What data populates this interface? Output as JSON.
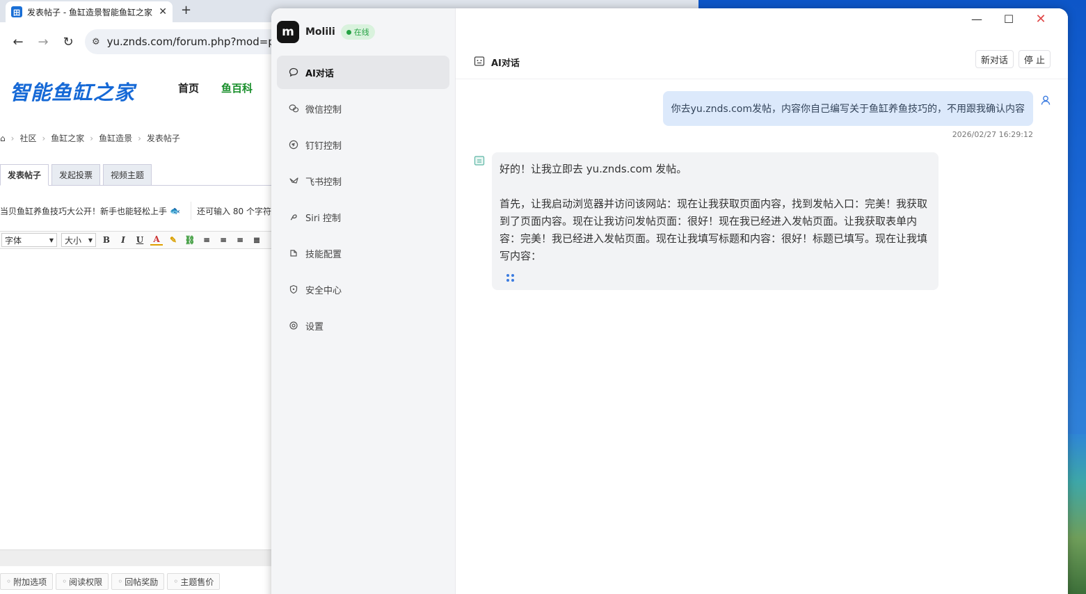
{
  "browser": {
    "tab_title": "发表帖子 - 鱼缸造景智能鱼缸之家",
    "url": "yu.znds.com/forum.php?mod=post&action=newthread"
  },
  "site": {
    "logo": "智能鱼缸之家",
    "nav": [
      "首页",
      "鱼百科"
    ],
    "breadcrumbs": [
      "社区",
      "鱼缸之家",
      "鱼缸造景",
      "发表帖子"
    ],
    "post_tabs": [
      "发表帖子",
      "发起投票",
      "视频主题"
    ],
    "subject_value": "当贝鱼缸养鱼技巧大公开！新手也能轻松上手",
    "subject_remaining": "还可输入 80 个字符",
    "editor": {
      "font": "字体",
      "size": "大小"
    },
    "options": [
      "附加选项",
      "阅读权限",
      "回帖奖励",
      "主题售价"
    ]
  },
  "app": {
    "name": "Molili",
    "status": "在线",
    "menu": [
      {
        "label": "AI对话",
        "icon": "chat-icon"
      },
      {
        "label": "微信控制",
        "icon": "wechat-icon"
      },
      {
        "label": "钉钉控制",
        "icon": "dingtalk-icon"
      },
      {
        "label": "飞书控制",
        "icon": "feishu-icon"
      },
      {
        "label": "Siri 控制",
        "icon": "siri-icon"
      },
      {
        "label": "技能配置",
        "icon": "skill-icon"
      },
      {
        "label": "安全中心",
        "icon": "shield-icon"
      },
      {
        "label": "设置",
        "icon": "gear-icon"
      }
    ],
    "chat": {
      "title": "AI对话",
      "new_chat": "新对话",
      "stop": "停 止",
      "user_message": "你去yu.znds.com发帖，内容你自己编写关于鱼缸养鱼技巧的，不用跟我确认内容",
      "user_time": "2026/02/27 16:29:12",
      "bot_line1": "好的！让我立即去 yu.znds.com 发帖。",
      "bot_line2": "首先，让我启动浏览器并访问该网站：现在让我获取页面内容，找到发帖入口：完美！我获取到了页面内容。现在让我访问发帖页面：很好！现在我已经进入发帖页面。让我获取表单内容：完美！我已经进入发帖页面。现在让我填写标题和内容：很好！标题已填写。现在让我填写内容："
    }
  }
}
